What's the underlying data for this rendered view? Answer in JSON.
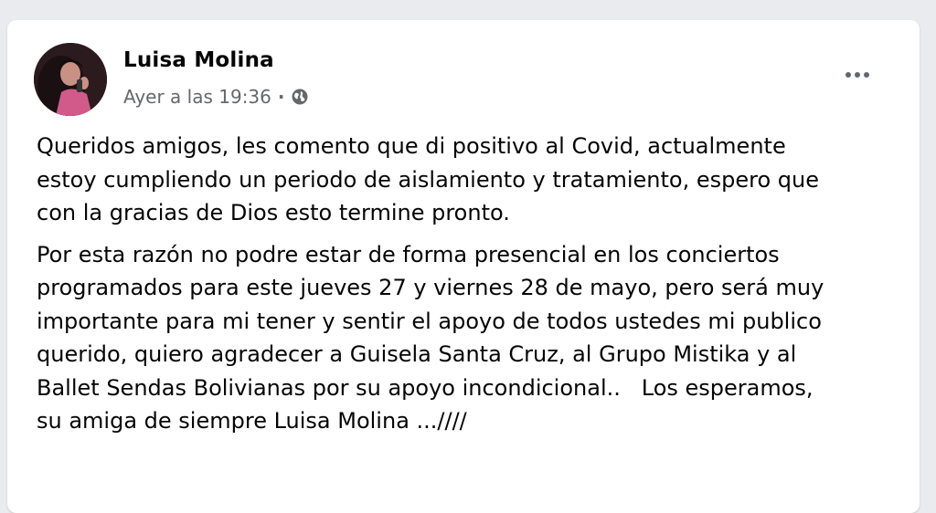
{
  "post": {
    "author": "Luisa Molina",
    "timestamp": "Ayer a las 19:36",
    "separator": "·",
    "privacy_icon": "globe-icon",
    "more_icon": "more-options-icon",
    "paragraph1": [
      "Queridos amigos, les comento que di positivo al Covid, actualmente",
      "estoy cumpliendo un periodo de aislamiento y tratamiento, espero que",
      "con la gracias de Dios esto termine pronto."
    ],
    "paragraph2": [
      "Por esta razón no podre estar de forma presencial en los conciertos",
      "programados para este jueves 27 y viernes 28 de mayo, pero será muy",
      "importante para mi tener y sentir el apoyo de todos ustedes mi publico",
      "querido, quiero agradecer a Guisela Santa Cruz, al Grupo Mistika y al",
      "Ballet Sendas Bolivianas por su apoyo incondicional..   Los esperamos,",
      "su amiga de siempre Luisa Molina ...////"
    ]
  },
  "colors": {
    "background": "#e9ebee",
    "card": "#ffffff",
    "text": "#050505",
    "meta_text": "#65676b"
  }
}
